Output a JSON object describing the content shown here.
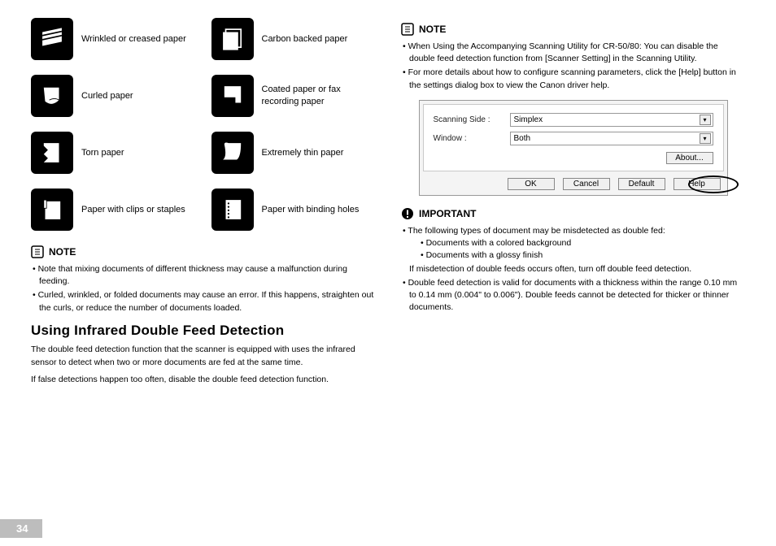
{
  "paperTypes": {
    "wrinkled": "Wrinkled or creased paper",
    "carbon": "Carbon backed paper",
    "curled": "Curled paper",
    "coated": "Coated paper or fax recording paper",
    "torn": "Torn paper",
    "thin": "Extremely thin paper",
    "clips": "Paper with clips or staples",
    "binding": "Paper with binding holes"
  },
  "note1": {
    "heading": "NOTE",
    "b1": "Note that mixing documents of different thickness may cause a malfunction during feeding.",
    "b2": "Curled, wrinkled, or folded documents may cause an error. If this happens, straighten out the curls, or reduce the number of documents loaded."
  },
  "sectionTitle": "Using Infrared Double Feed Detection",
  "sectionBody1": "The double feed detection function that the scanner is equipped with uses the infrared sensor to detect when two or more documents are fed at the same time.",
  "sectionBody2": "If false detections happen too often, disable the double feed detection function.",
  "note2": {
    "heading": "NOTE",
    "b1": "When Using the Accompanying Scanning Utility for CR-50/80: You can disable the double feed detection function from [Scanner Setting] in the Scanning Utility.",
    "b2": "For more details about how to configure scanning parameters, click the [Help] button in the settings dialog box to view the Canon driver help."
  },
  "dialog": {
    "scanSideLabel": "Scanning Side :",
    "scanSideValue": "Simplex",
    "windowLabel": "Window :",
    "windowValue": "Both",
    "about": "About...",
    "ok": "OK",
    "cancel": "Cancel",
    "defaultBtn": "Default",
    "help": "Help"
  },
  "important": {
    "heading": "IMPORTANT",
    "b1": "The following types of document may be misdetected as double fed:",
    "s1": "Documents with a colored background",
    "s2": "Documents with a glossy finish",
    "after": "If misdetection of double feeds occurs often, turn off double feed detection.",
    "b2": "Double feed detection is valid for documents with a thickness within the range 0.10 mm to 0.14 mm (0.004\" to 0.006\"). Double feeds cannot be detected for thicker or thinner documents."
  },
  "pageNumber": "34"
}
